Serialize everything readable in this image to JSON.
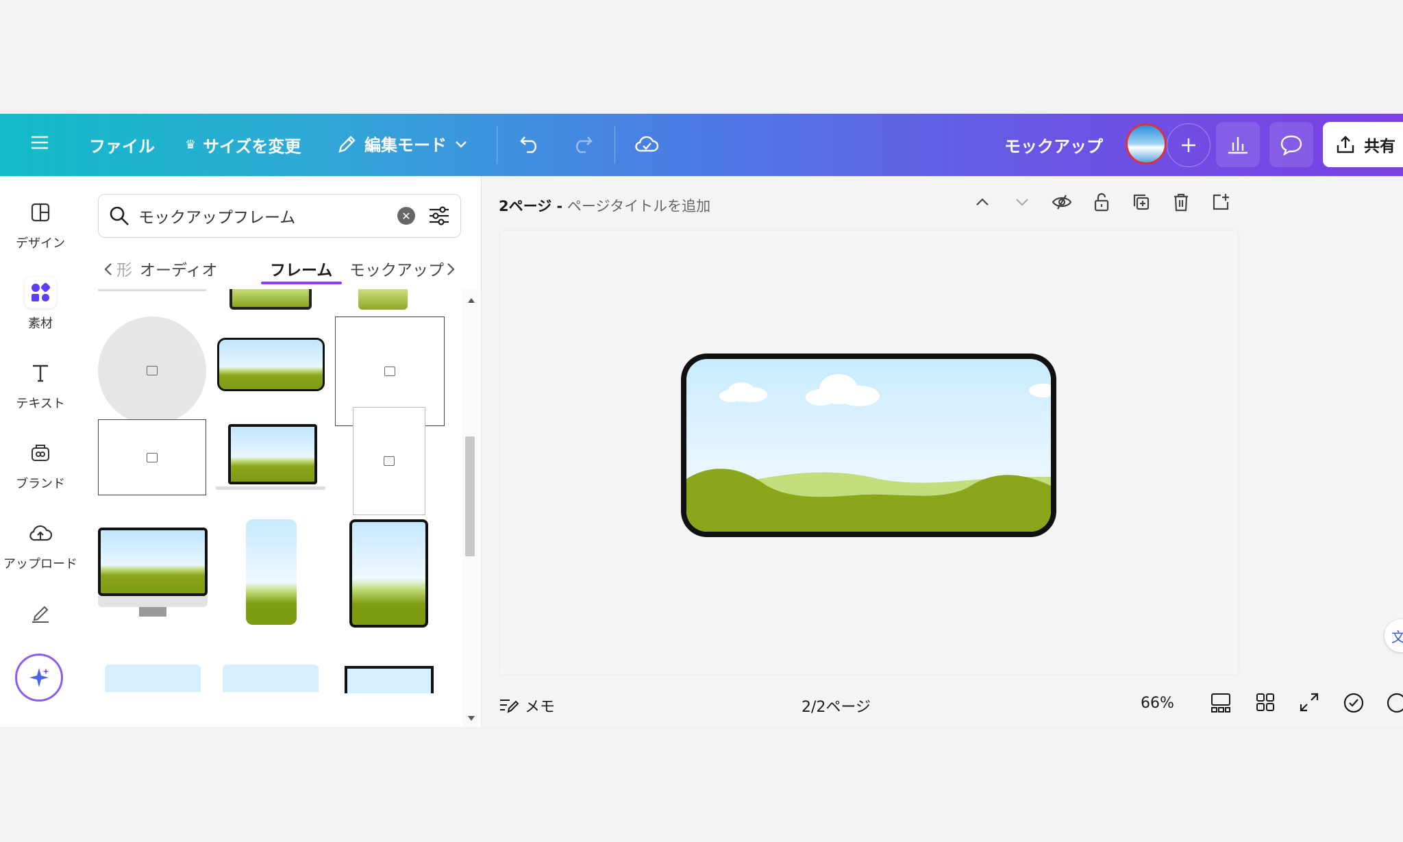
{
  "topbar": {
    "file": "ファイル",
    "resize": "サイズを変更",
    "edit_mode": "編集モード",
    "doc_title": "モックアップ",
    "share": "共有"
  },
  "rail": {
    "design": "デザイン",
    "elements": "素材",
    "text": "テキスト",
    "brand": "ブランド",
    "uploads": "アップロード"
  },
  "panel": {
    "search_value": "モックアップフレーム",
    "tabs": [
      "形",
      "オーディオ",
      "フレーム",
      "モックアップ"
    ],
    "active_tab": "フレーム"
  },
  "canvas": {
    "page_label": "2ページ -",
    "page_title_placeholder": "ページタイトルを追加"
  },
  "bottom": {
    "notes": "メモ",
    "page_count": "2/2ページ",
    "zoom": "66%",
    "zoom_level": 0.48
  },
  "colors": {
    "accent": "#8b3dff",
    "grass": "#7e9c12"
  }
}
